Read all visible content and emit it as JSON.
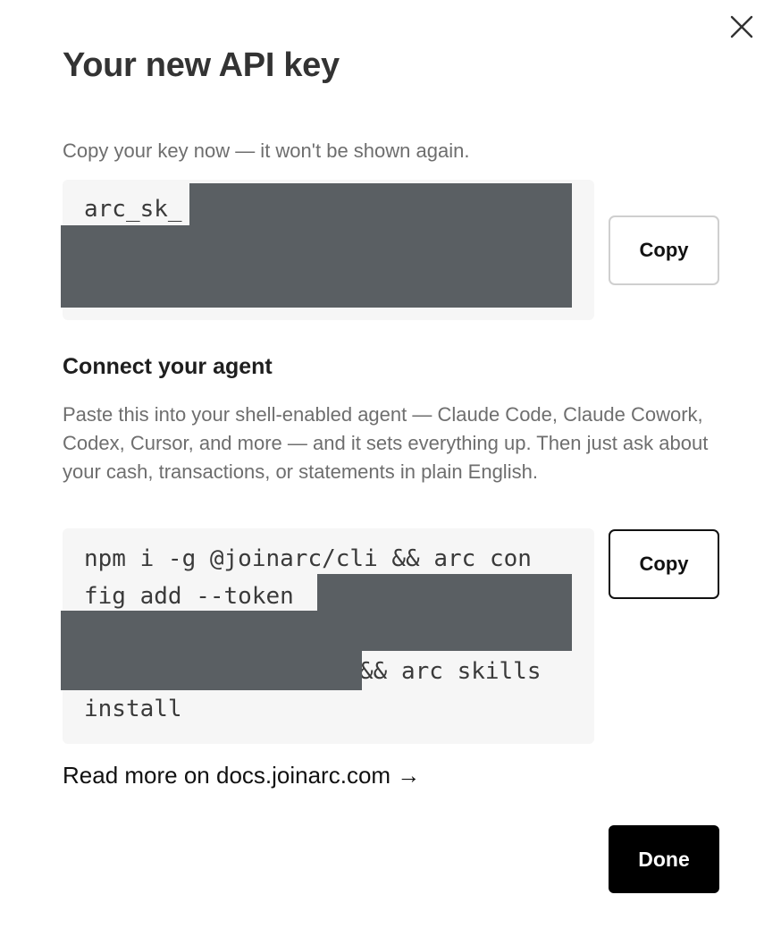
{
  "dialog": {
    "title": "Your new API key",
    "close_icon": "close-icon"
  },
  "api_key": {
    "hint": "Copy your key now — it won't be shown again.",
    "prefix": "arc_sk_",
    "copy_label": "Copy"
  },
  "connect": {
    "heading": "Connect your agent",
    "description": "Paste this into your shell-enabled agent — Claude Code, Claude Cowork, Codex, Cursor, and more — and it sets everything up. Then just ask about your cash, transactions, or statements in plain English.",
    "command_line1": "npm i -g @joinarc/cli && arc con",
    "command_line2": "fig add --token",
    "command_line4": "&& arc skills",
    "command_line5": "install",
    "copy_label": "Copy"
  },
  "docs_link": "Read more on docs.joinarc.com →",
  "done_label": "Done",
  "colors": {
    "redaction": "#5a5f63",
    "code_background": "#f6f6f6",
    "primary_button": "#000000"
  }
}
